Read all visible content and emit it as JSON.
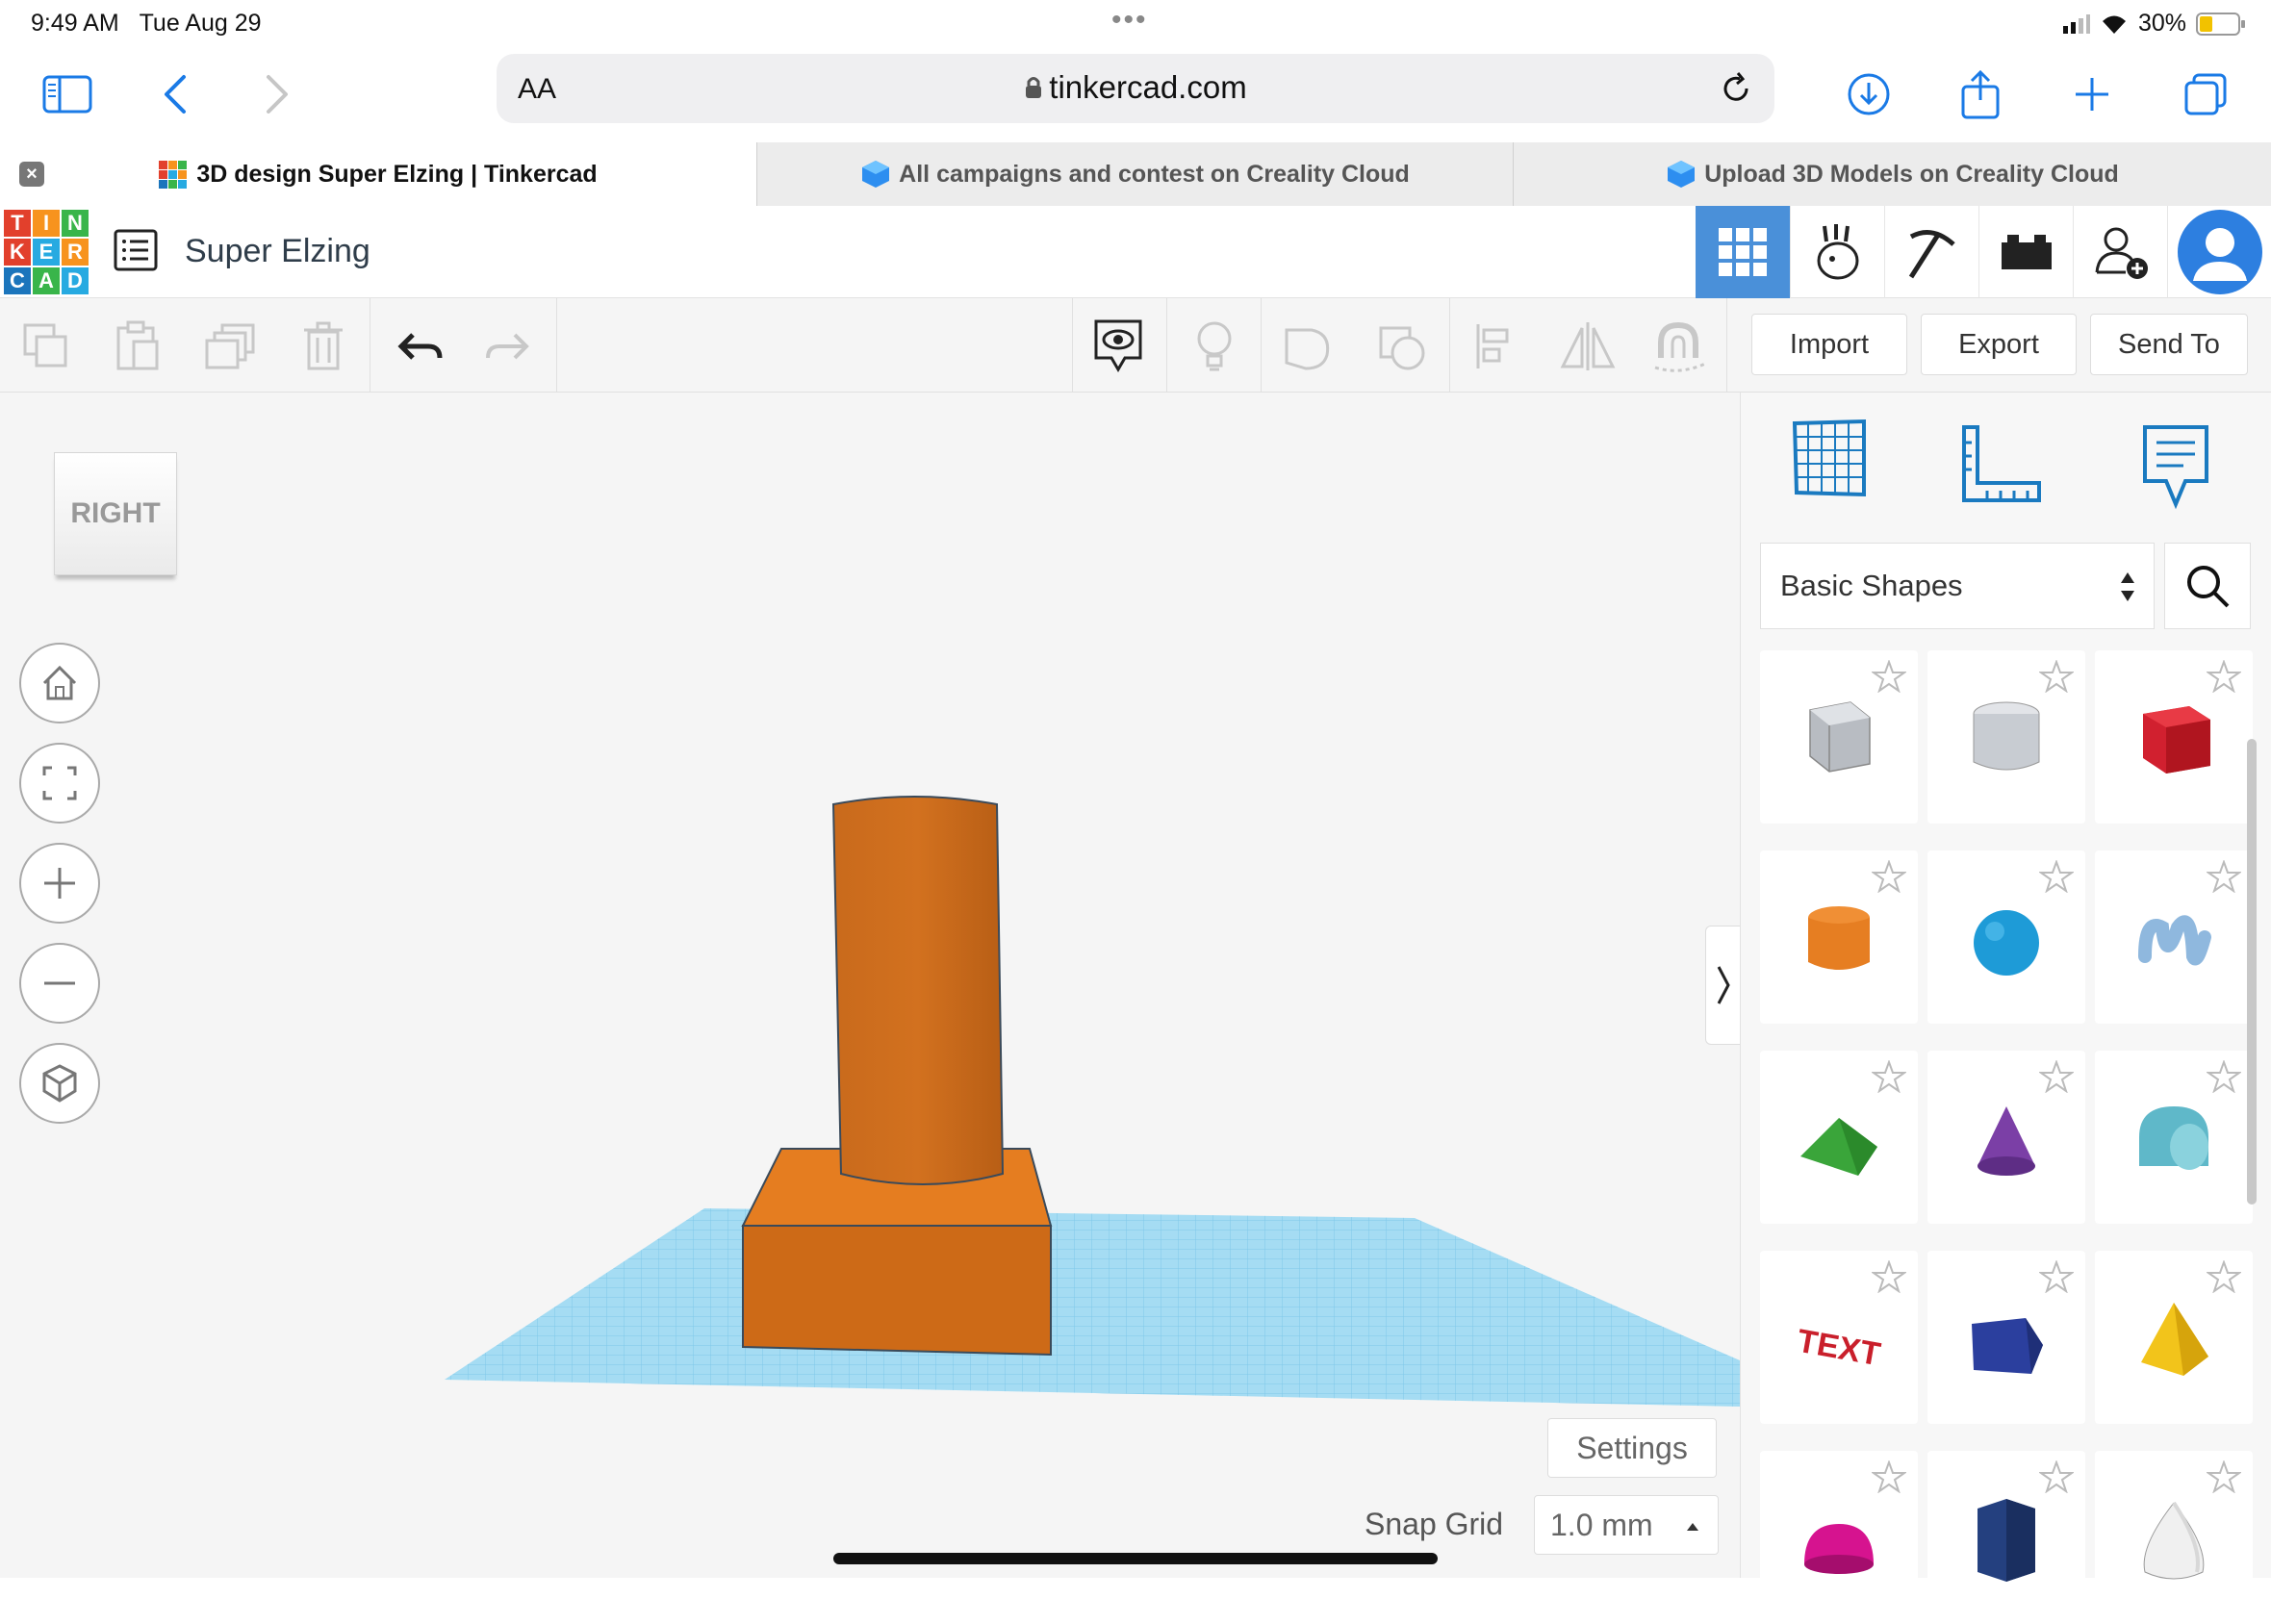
{
  "status": {
    "time": "9:49 AM",
    "date": "Tue Aug 29",
    "battery": "30%"
  },
  "browser": {
    "aa_label": "AA",
    "url": "tinkercad.com",
    "tabs": [
      {
        "label": "3D design Super Elzing | Tinkercad",
        "active": true
      },
      {
        "label": "All campaigns and contest on Creality Cloud",
        "active": false
      },
      {
        "label": "Upload 3D Models on Creality Cloud",
        "active": false
      }
    ]
  },
  "app": {
    "logo_letters": [
      "T",
      "I",
      "N",
      "K",
      "E",
      "R",
      "C",
      "A",
      "D"
    ],
    "logo_colors": [
      "#e2402c",
      "#f7931e",
      "#39b54a",
      "#e2402c",
      "#27aae1",
      "#f7931e",
      "#1b75bc",
      "#39b54a",
      "#27aae1"
    ],
    "design_title": "Super Elzing",
    "accent": "#4a90d9"
  },
  "toolbar": {
    "import_label": "Import",
    "export_label": "Export",
    "send_to_label": "Send To"
  },
  "viewcube": {
    "face": "RIGHT"
  },
  "panel": {
    "category": "Basic Shapes",
    "shapes": [
      {
        "name": "Box Hole",
        "color": "#b8bcc2"
      },
      {
        "name": "Cylinder Hole",
        "color": "#c8ccd2"
      },
      {
        "name": "Box",
        "color": "#d1202f"
      },
      {
        "name": "Cylinder",
        "color": "#e67e22"
      },
      {
        "name": "Sphere",
        "color": "#1e9bd7"
      },
      {
        "name": "Scribble",
        "color": "#8fb8de"
      },
      {
        "name": "Roof",
        "color": "#3aa53a"
      },
      {
        "name": "Cone",
        "color": "#7b3fa6"
      },
      {
        "name": "Round Roof",
        "color": "#5fb8c9"
      },
      {
        "name": "Text",
        "color": "#c91f2b"
      },
      {
        "name": "Polygon",
        "color": "#2b3f9e"
      },
      {
        "name": "Pyramid",
        "color": "#f2c41b"
      },
      {
        "name": "Half Sphere",
        "color": "#d6138f"
      },
      {
        "name": "Hexagonal Prism",
        "color": "#24407f"
      },
      {
        "name": "Paraboloid",
        "color": "#d8d8d8"
      }
    ]
  },
  "footer": {
    "settings_label": "Settings",
    "snap_grid_label": "Snap Grid",
    "snap_grid_value": "1.0 mm"
  }
}
